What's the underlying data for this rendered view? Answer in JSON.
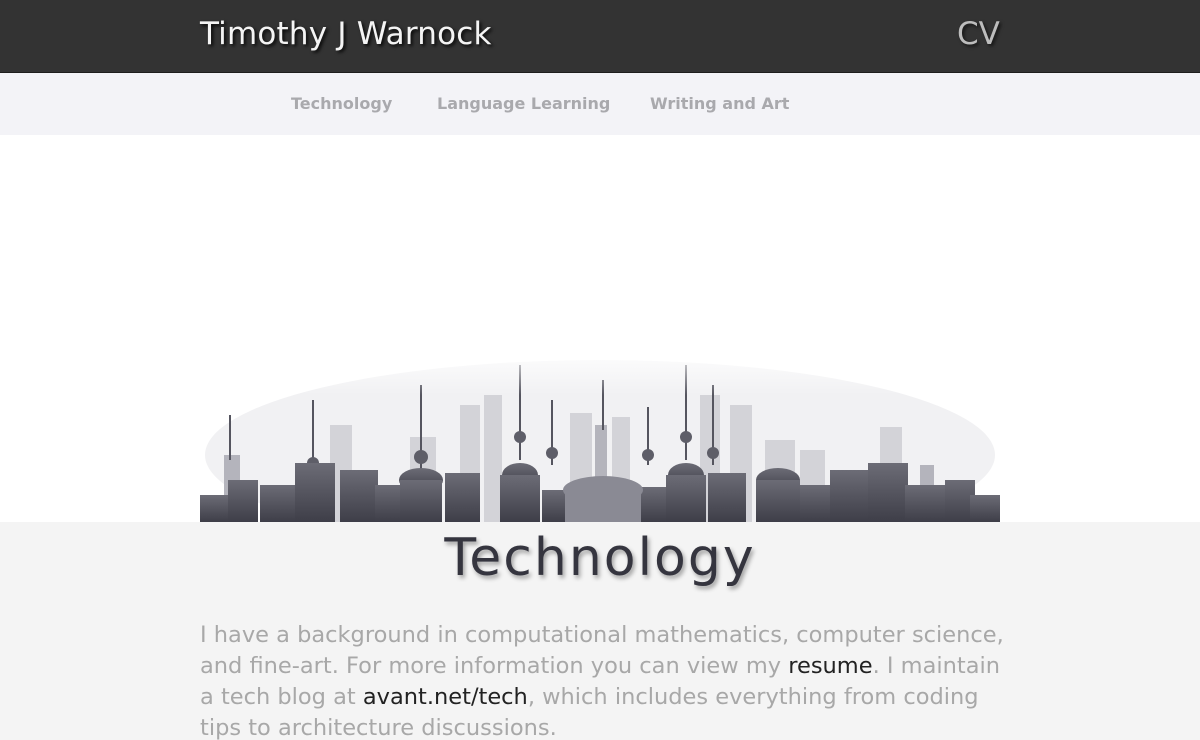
{
  "header": {
    "title": "Timothy J Warnock",
    "cv_label": "CV"
  },
  "nav": {
    "items": [
      {
        "label": "Technology"
      },
      {
        "label": "Language Learning"
      },
      {
        "label": "Writing and Art"
      }
    ]
  },
  "main": {
    "heading": "Technology",
    "intro": {
      "part1": "I have a background in computational mathematics, computer science, and fine-art. For more information you can view my ",
      "resume_link": "resume",
      "part2": ". I maintain a tech blog at ",
      "blog_link": "avant.net/tech",
      "part3": ", which includes everything from coding tips to architecture discussions."
    }
  },
  "colors": {
    "header_bg": "#333333",
    "subnav_bg": "#f3f3f7",
    "content_bg": "#f4f4f4",
    "link": "#222222"
  }
}
